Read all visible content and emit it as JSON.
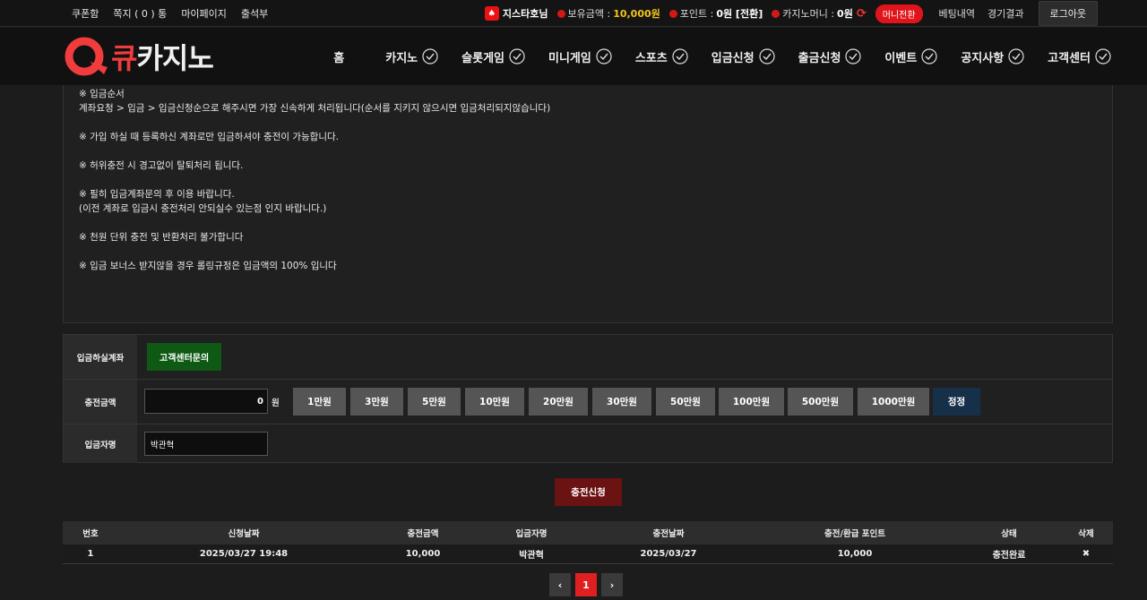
{
  "topbar": {
    "links": [
      "쿠폰함",
      "쪽지 ( 0 ) 통",
      "마이페이지",
      "출석부"
    ],
    "user_name": "지스타호님",
    "balance_label": "보유금액 :",
    "balance_value": "10,000원",
    "point_label": "포인트 :",
    "point_value": "0원 [전환]",
    "casino_money_label": "카지노머니 :",
    "casino_money_value": "0원",
    "money_convert": "머니전환",
    "betting_history": "베팅내역",
    "game_results": "경기결과",
    "logout": "로그아웃"
  },
  "header": {
    "logo_part1": "큐",
    "logo_part2": "카지노",
    "nav": [
      "홈",
      "카지노",
      "슬롯게임",
      "미니게임",
      "스포츠",
      "입금신청",
      "출금신청",
      "이벤트",
      "공지사항",
      "고객센터"
    ]
  },
  "notice": {
    "lines": [
      "※ 입금순서",
      "계좌요청 > 입금 > 입금신청순으로 해주시면 가장 신속하게 처리됩니다(순서를 지키지 않으시면 입금처리되지않습니다)",
      "",
      "※ 가입 하실 때 등록하신 계좌로만 입금하셔야 충전이 가능합니다.",
      "",
      "※ 허위충전 시 경고없이 탈퇴처리 됩니다.",
      "",
      "※ 필히 입금계좌문의 후 이용 바랍니다.",
      "(이전 계좌로 입금시 충전처리 안되실수 있는점 인지 바랍니다.)",
      "",
      "※ 천원 단위 충전 및 반환처리 불가합니다",
      "",
      "※ 입금 보너스 받지않을 경우 롤링규정은 입금액의 100% 입니다"
    ]
  },
  "form": {
    "account_label": "입금하실계좌",
    "account_button": "고객센터문의",
    "amount_label": "충전금액",
    "amount_value": "0",
    "amount_unit": "원",
    "amount_buttons": [
      "1만원",
      "3만원",
      "5만원",
      "10만원",
      "20만원",
      "30만원",
      "50만원",
      "100만원",
      "500만원",
      "1000만원"
    ],
    "reset_button": "정정",
    "depositor_label": "입금자명",
    "depositor_value": "박관혁"
  },
  "submit_label": "충전신청",
  "table": {
    "headers": [
      "번호",
      "신청날짜",
      "충전금액",
      "입금자명",
      "충전날짜",
      "충전/환급 포인트",
      "상태",
      "삭제"
    ],
    "rows": [
      [
        "1",
        "2025/03/27 19:48",
        "10,000",
        "박관혁",
        "2025/03/27",
        "10,000",
        "충전완료",
        "✖"
      ]
    ]
  },
  "pagination": {
    "prev": "‹",
    "current": "1",
    "next": "›"
  },
  "colors": {
    "accent_red": "#e0141a",
    "brand_red": "#f03c3c",
    "gold": "#f0c419",
    "green_button": "#0e5a14",
    "submit_button": "#6b1212",
    "reset_button": "#16304a"
  }
}
